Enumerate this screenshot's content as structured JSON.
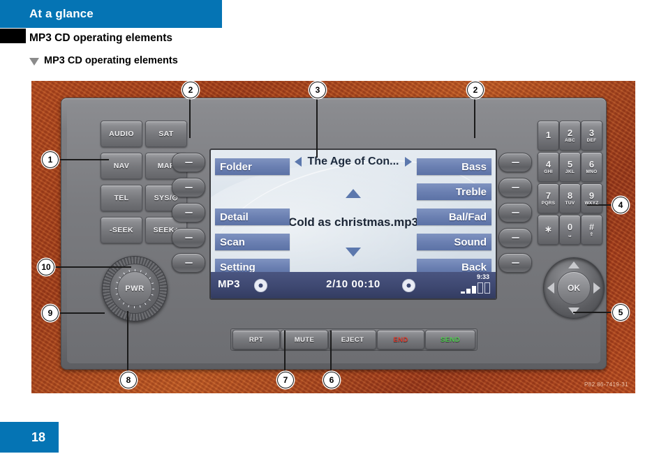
{
  "header": {
    "chapter": "At a glance",
    "subtitle": "MP3 CD operating elements",
    "section": "MP3 CD operating elements",
    "section_marker": "triangle-down-icon"
  },
  "figure": {
    "watermark": "P82.86-7419-31",
    "callouts": [
      {
        "id": "1",
        "label": "1"
      },
      {
        "id": "2a",
        "label": "2"
      },
      {
        "id": "3",
        "label": "3"
      },
      {
        "id": "2b",
        "label": "2"
      },
      {
        "id": "4",
        "label": "4"
      },
      {
        "id": "5",
        "label": "5"
      },
      {
        "id": "6",
        "label": "6"
      },
      {
        "id": "7",
        "label": "7"
      },
      {
        "id": "8",
        "label": "8"
      },
      {
        "id": "9",
        "label": "9"
      },
      {
        "id": "10",
        "label": "10"
      }
    ]
  },
  "radio": {
    "function_keys": [
      {
        "label": "AUDIO"
      },
      {
        "label": "SAT"
      },
      {
        "label": "NAV"
      },
      {
        "label": "MAP"
      },
      {
        "label": "TEL"
      },
      {
        "label": "SYS/⊙"
      },
      {
        "label": "-SEEK"
      },
      {
        "label": "SEEK+"
      }
    ],
    "power_knob": {
      "label": "PWR"
    },
    "bottom_keys": [
      {
        "label": "RPT",
        "color": "#f0f0f2"
      },
      {
        "label": "MUTE",
        "color": "#f0f0f2"
      },
      {
        "label": "EJECT",
        "color": "#f0f0f2"
      },
      {
        "label": "END",
        "color": "#e03c2e"
      },
      {
        "label": "SEND",
        "color": "#4fd14f"
      }
    ],
    "keypad": [
      {
        "num": "1",
        "sub": ""
      },
      {
        "num": "2",
        "sub": "ABC"
      },
      {
        "num": "3",
        "sub": "DEF"
      },
      {
        "num": "4",
        "sub": "GHI"
      },
      {
        "num": "5",
        "sub": "JKL"
      },
      {
        "num": "6",
        "sub": "MNO"
      },
      {
        "num": "7",
        "sub": "PQRS"
      },
      {
        "num": "8",
        "sub": "TUV"
      },
      {
        "num": "9",
        "sub": "WXYZ"
      },
      {
        "num": "∗",
        "sub": ""
      },
      {
        "num": "0",
        "sub": "␣"
      },
      {
        "num": "#",
        "sub": "⇧"
      }
    ],
    "ok_pad": {
      "center_label": "OK",
      "up": "arrow-up-icon",
      "down": "arrow-down-icon",
      "left": "arrow-left-icon",
      "right": "arrow-right-icon"
    },
    "soft_keys_left": [
      "softkey-1",
      "softkey-2",
      "softkey-3",
      "softkey-4",
      "softkey-5"
    ],
    "soft_keys_right": [
      "softkey-6",
      "softkey-7",
      "softkey-8",
      "softkey-9",
      "softkey-10"
    ]
  },
  "display": {
    "menu_left": [
      {
        "label": "Folder"
      },
      {
        "label": ""
      },
      {
        "label": "Detail"
      },
      {
        "label": "Scan"
      },
      {
        "label": "Setting"
      }
    ],
    "menu_right": [
      {
        "label": "Bass"
      },
      {
        "label": "Treble"
      },
      {
        "label": "Bal/Fad"
      },
      {
        "label": "Sound"
      },
      {
        "label": "Back"
      }
    ],
    "title": "The Age of Con...",
    "title_prev_icon": "triangle-left-icon",
    "title_next_icon": "triangle-right-icon",
    "scroll_up_icon": "triangle-up-icon",
    "scroll_down_icon": "triangle-down-icon",
    "track_name": "Cold as christmas.mp3",
    "status": {
      "source": "MP3",
      "disc_icon": "disc-icon",
      "track_position": "2/10  00:10",
      "clock": "9:33",
      "signal_icon": "signal-bars-icon"
    },
    "accent_color": "#6b80b2",
    "status_bg": "#3e4871"
  },
  "footer": {
    "page_number": "18",
    "accent_color": "#0574b4"
  }
}
